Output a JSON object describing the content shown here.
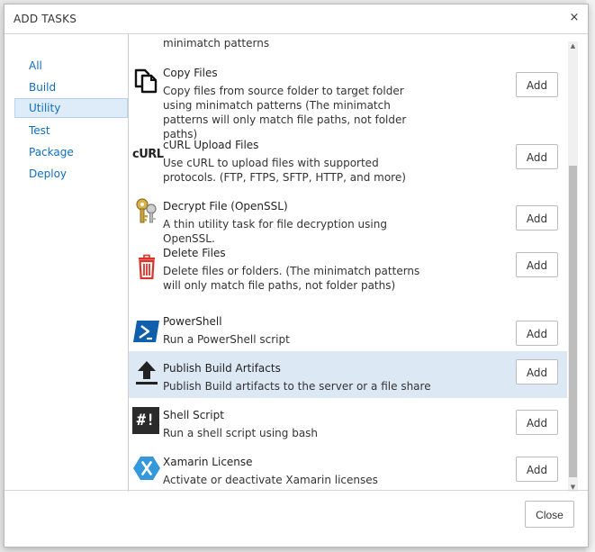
{
  "dialog": {
    "title": "ADD TASKS",
    "close_glyph": "×",
    "close_button_label": "Close"
  },
  "categories": [
    {
      "label": "All",
      "selected": false
    },
    {
      "label": "Build",
      "selected": false
    },
    {
      "label": "Utility",
      "selected": true
    },
    {
      "label": "Test",
      "selected": false
    },
    {
      "label": "Package",
      "selected": false
    },
    {
      "label": "Deploy",
      "selected": false
    }
  ],
  "partial_top_text": "minimatch patterns",
  "tasks": [
    {
      "name": "Copy Files",
      "description": "Copy files from source folder to target folder using minimatch patterns (The minimatch patterns will only match file paths, not folder paths)",
      "icon": "copy-files-icon",
      "add_label": "Add"
    },
    {
      "name": "cURL Upload Files",
      "description": "Use cURL to upload files with supported protocols. (FTP, FTPS, SFTP, HTTP, and more)",
      "icon": "curl-icon",
      "icon_text": "cURL",
      "add_label": "Add"
    },
    {
      "name": "Decrypt File (OpenSSL)",
      "description": "A thin utility task for file decryption using OpenSSL.",
      "icon": "keys-icon",
      "add_label": "Add"
    },
    {
      "name": "Delete Files",
      "description": "Delete files or folders. (The minimatch patterns will only match file paths, not folder paths)",
      "icon": "trash-icon",
      "add_label": "Add"
    },
    {
      "name": "PowerShell",
      "description": "Run a PowerShell script",
      "icon": "powershell-icon",
      "add_label": "Add"
    },
    {
      "name": "Publish Build Artifacts",
      "description": "Publish Build artifacts to the server or a file share",
      "icon": "upload-icon",
      "add_label": "Add",
      "highlighted": true
    },
    {
      "name": "Shell Script",
      "description": "Run a shell script using bash",
      "icon": "shell-script-icon",
      "icon_text": "#!",
      "add_label": "Add"
    },
    {
      "name": "Xamarin License",
      "description": "Activate or deactivate Xamarin licenses",
      "icon": "xamarin-icon",
      "add_label": "Add"
    }
  ],
  "colors": {
    "link": "#106ebe",
    "selected_bg": "#deecf9",
    "highlight_row": "#dde8f5",
    "powershell": "#0f5fad",
    "xamarin": "#3498db",
    "trash": "#d9342b"
  }
}
